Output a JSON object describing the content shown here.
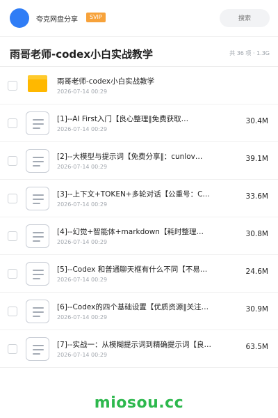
{
  "topbar": {
    "app_name": "夸克网盘分享",
    "badge": "SVIP",
    "search_placeholder": "搜索"
  },
  "folder": {
    "title": "雨哥老师-codex小白实战教学",
    "meta": "共 36 项 · 1.3G"
  },
  "items": [
    {
      "name": "雨哥老师-codex小白实战教学",
      "date": "2026-07-14 00:29",
      "size": "",
      "type": "folder"
    },
    {
      "name": "[1]--AI First入门【良心整理‖免费获取…",
      "date": "2026-07-14 00:29",
      "size": "30.4M",
      "type": "file"
    },
    {
      "name": "[2]--大模型与提示词【免费分享‖：cunlov…",
      "date": "2026-07-14 00:29",
      "size": "39.1M",
      "type": "file"
    },
    {
      "name": "[3]--上下文+TOKEN+多轮对话【公重号：C…",
      "date": "2026-07-14 00:29",
      "size": "33.6M",
      "type": "file"
    },
    {
      "name": "[4]--幻觉+智能体+markdown【耗时整理…",
      "date": "2026-07-14 00:29",
      "size": "30.8M",
      "type": "file"
    },
    {
      "name": "[5]--Codex 和普通聊天框有什么不同【不易…",
      "date": "2026-07-14 00:29",
      "size": "24.6M",
      "type": "file"
    },
    {
      "name": "[6]--Codex的四个基础设置【优质资源‖关注…",
      "date": "2026-07-14 00:29",
      "size": "30.9M",
      "type": "file"
    },
    {
      "name": "[7]--实战一：从模糊提示词到精确提示词【良心整…",
      "date": "2026-07-14 00:29",
      "size": "63.5M",
      "type": "file"
    }
  ],
  "watermark": "miosou.cc",
  "colors": {
    "accent_blue": "#2f7df6",
    "svip_orange": "#f7a23a",
    "folder_yellow": "#ffb800",
    "watermark_green": "#2db84d"
  }
}
